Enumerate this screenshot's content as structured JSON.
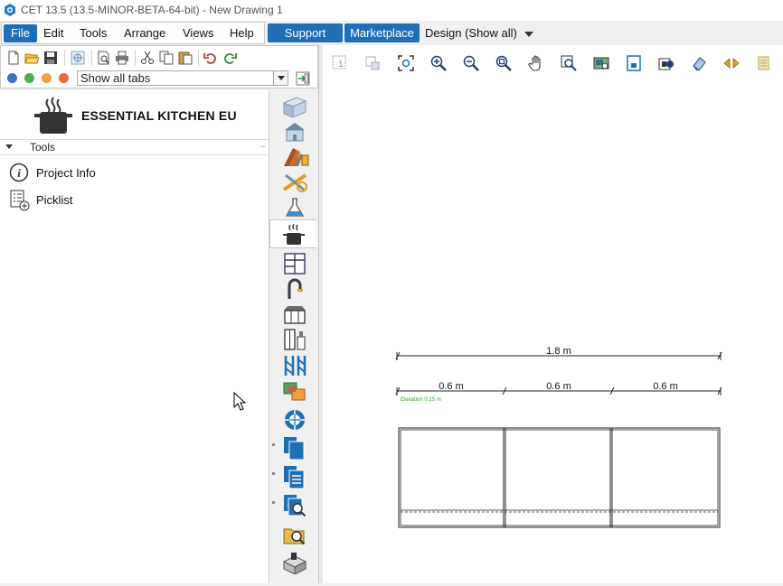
{
  "window": {
    "title": "CET 13.5 (13.5-MINOR-BETA-64-bit) - New Drawing 1",
    "icon": "cet-app-icon"
  },
  "menu": {
    "items": [
      "File",
      "Edit",
      "Tools",
      "Arrange",
      "Views",
      "Help"
    ]
  },
  "header_buttons": {
    "support": "Support",
    "marketplace": "Marketplace"
  },
  "design_selector": {
    "value": "Design (Show all)"
  },
  "left_toolbar": {
    "icons": [
      "new-document-icon",
      "open-folder-icon",
      "save-icon",
      "render-icon",
      "print-preview-icon",
      "print-icon",
      "cut-icon",
      "copy-icon",
      "paste-icon",
      "undo-icon",
      "redo-icon"
    ],
    "tab_select": {
      "value": "Show all tabs"
    },
    "colors": {
      "blue": "#3b6fc8",
      "green": "#4caf50",
      "orange": "#f0a040",
      "red": "#e86a3a"
    }
  },
  "panel": {
    "brand": "ESSENTIAL KITCHEN EU",
    "section_label": "Tools",
    "tools": [
      {
        "label": "Project Info",
        "icon": "info-icon"
      },
      {
        "label": "Picklist",
        "icon": "picklist-icon"
      }
    ]
  },
  "side_tabs": [
    "building-walls-icon",
    "house-icon",
    "materials-icon",
    "measure-tools-icon",
    "lab-flask-icon",
    "kitchen-pot-icon",
    "cabinets-icon",
    "faucet-icon",
    "kitchen-front-icon",
    "appliances-icon",
    "scaffold-icon",
    "blocks-icon",
    "globe-catalog-icon",
    "documents-icon",
    "documents-list-icon",
    "documents-search-icon",
    "folder-search-icon",
    "parts-bin-icon"
  ],
  "canvas_toolbar": [
    "zoom-1-icon",
    "zoom-select-icon",
    "zoom-extents-icon",
    "zoom-in-icon",
    "zoom-out-icon",
    "zoom-window-icon",
    "pan-hand-icon",
    "zoom-preview-icon",
    "camera-view-icon",
    "frame-view-icon",
    "layers-icon",
    "eraser-icon",
    "navigate-arrows-icon",
    "notes-icon"
  ],
  "drawing": {
    "total_dimension": "1.8 m",
    "segment_dimensions": [
      "0.6 m",
      "0.6 m",
      "0.6 m"
    ],
    "elevation_label": "Elevation 0.15 m"
  }
}
